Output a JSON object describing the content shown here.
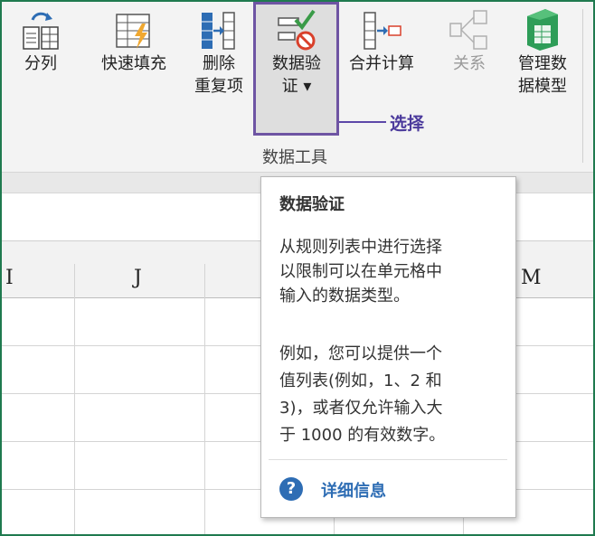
{
  "ribbon": {
    "buttons": [
      {
        "label": "分列",
        "icon": "text-to-columns-icon"
      },
      {
        "label": "快速填充",
        "icon": "flash-fill-icon"
      },
      {
        "label1": "删除",
        "label2": "重复项",
        "icon": "remove-duplicates-icon"
      },
      {
        "label1": "数据验",
        "label2": "证 ▾",
        "icon": "data-validation-icon"
      },
      {
        "label": "合并计算",
        "icon": "consolidate-icon"
      },
      {
        "label": "关系",
        "icon": "relationships-icon"
      },
      {
        "label1": "管理数",
        "label2": "据模型",
        "icon": "manage-data-model-icon"
      }
    ],
    "group_label": "数据工具"
  },
  "annotation": {
    "label": "选择",
    "color": "#4b3a9c"
  },
  "columns": [
    "I",
    "J",
    "M"
  ],
  "tooltip": {
    "title": "数据验证",
    "description": [
      "从规则列表中进行选择",
      "以限制可以在单元格中",
      "输入的数据类型。"
    ],
    "example": [
      "例如，您可以提供一个",
      "值列表(例如，1、2 和",
      "3)，或者仅允许输入大",
      "于 1000 的有效数字。"
    ],
    "help_link": "详细信息"
  },
  "colors": {
    "frame": "#1f7a4f",
    "highlight_border": "#6e54a3",
    "help_blue": "#2e6db4"
  }
}
